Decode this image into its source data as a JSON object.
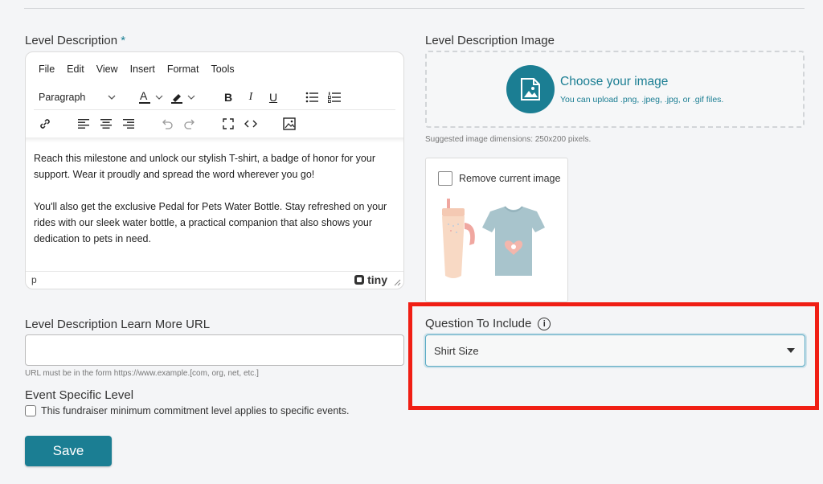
{
  "description": {
    "label": "Level Description",
    "required_mark": "*",
    "menu": [
      "File",
      "Edit",
      "View",
      "Insert",
      "Format",
      "Tools"
    ],
    "format_select": "Paragraph",
    "paragraphs": [
      "Reach this milestone and unlock our stylish T-shirt, a badge of honor for your support. Wear it proudly and spread the word wherever you go!",
      "You'll also get the exclusive Pedal for Pets Water Bottle. Stay refreshed on your rides with our sleek water bottle, a practical companion that also shows your dedication to pets in need."
    ],
    "status_path": "p",
    "brand": "tiny"
  },
  "image": {
    "label": "Level Description Image",
    "choose_title": "Choose your image",
    "choose_sub": "You can upload .png, .jpeg, .jpg, or .gif files.",
    "dimensions_hint": "Suggested image dimensions: 250x200 pixels.",
    "remove_label": "Remove current image"
  },
  "learn_more": {
    "label": "Level Description Learn More URL",
    "value": "",
    "hint": "URL must be in the form https://www.example.[com, org, net, etc.]"
  },
  "event_level": {
    "label": "Event Specific Level",
    "checkbox_label": "This fundraiser minimum commitment level applies to specific events."
  },
  "question": {
    "label": "Question To Include",
    "selected": "Shirt Size"
  },
  "save_label": "Save",
  "colors": {
    "accent": "#1b7e93",
    "highlight": "#f01e14"
  }
}
